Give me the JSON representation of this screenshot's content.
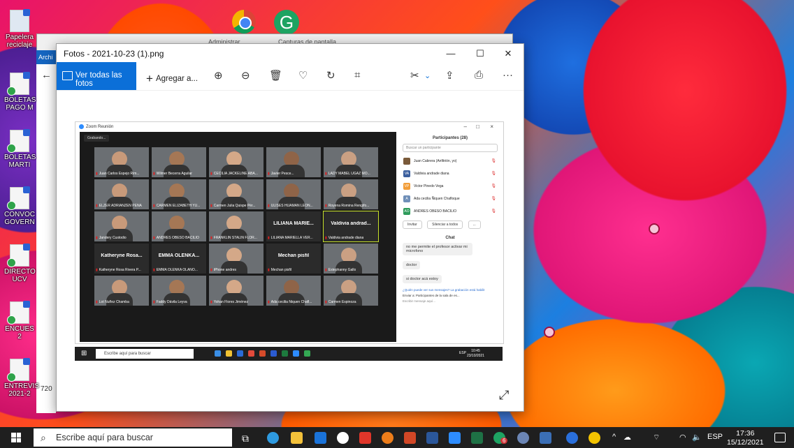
{
  "desktop": {
    "icons": [
      {
        "label": "Papelera reciclaje"
      },
      {
        "label": "BOLETAS PAGO M"
      },
      {
        "label": "BOLETAS MARTI"
      },
      {
        "label": "CONVOC GOVERN"
      },
      {
        "label": "DIRECTO UCV"
      },
      {
        "label": "ENCUES 2"
      },
      {
        "label": "ENTREVIS 2021-2"
      }
    ],
    "behind_window": {
      "tab1": "Administrar",
      "tab2": "Capturas de pantalla",
      "tab0": "Archi",
      "side_text": "720"
    }
  },
  "photos_app": {
    "title": "Fotos - 2021-10-23 (1).png",
    "see_all": "Ver todas las fotos",
    "add": "Agregar a...",
    "controls": {
      "minimize": "—",
      "maximize": "☐",
      "close": "✕",
      "more": "···"
    }
  },
  "zoom": {
    "title": "Zoom Reunión",
    "recording": "Grabando...",
    "participants_header": "Participantes (28)",
    "search_placeholder": "Buscar un participante",
    "tiles": [
      {
        "name": "Juan Carlos Espejo Rim..."
      },
      {
        "name": "Wilmer Becerra Aguilar"
      },
      {
        "name": "CECILIA JACKELINE ABA..."
      },
      {
        "name": "Javier Pesce..."
      },
      {
        "name": "LADY MABEL UGAZ MO..."
      },
      {
        "name": "ELZER ADRIANZEN PEÑA"
      },
      {
        "name": "CARMEN ELIZABETH YU..."
      },
      {
        "name": "Carmen Julia Quispe Pér..."
      },
      {
        "name": "ULISES HUAMAN LEON..."
      },
      {
        "name": "Royena Romina Rengifo..."
      },
      {
        "name": "Jandery Custodio"
      },
      {
        "name": "ANDRES OBESO BACILIO"
      },
      {
        "name": "FRANKLIN STALIN FLOR..."
      },
      {
        "name": "LILIANA MARIELLA VER...",
        "big": "LILIANA MARIE..."
      },
      {
        "name": "Valdivia andrade diana",
        "big": "Valdivia andrad..."
      },
      {
        "name": "Katheryne Rosa Rivera P...",
        "big": "Katheryne Rosa..."
      },
      {
        "name": "EMMA OLENKA OLANO...",
        "big": "EMMA OLENKA..."
      },
      {
        "name": "iPhone andres"
      },
      {
        "name": "Mechan pisfil",
        "big": "Mechan pisfil"
      },
      {
        "name": "Estephanny Gallo"
      },
      {
        "name": "Lot Nuñez Chamba"
      },
      {
        "name": "Faddy Dávila Leyva"
      },
      {
        "name": "Yohan Flores Jiménez"
      },
      {
        "name": "Ada cecilia Ñiquen Chafl..."
      },
      {
        "name": "Carmen Espinoza"
      }
    ],
    "participants": [
      {
        "initials": "",
        "name": "Juan Cabrera (Anfitrión, yo)"
      },
      {
        "initials": "VA",
        "name": "Valdivia andrade diana"
      },
      {
        "initials": "VP",
        "name": "Victor Pinedo Vega"
      },
      {
        "initials": "A",
        "name": "Ada cecilia Ñiquen Chafloque"
      },
      {
        "initials": "AO",
        "name": "ANDRES OBESO BACILIO"
      }
    ],
    "buttons": {
      "invite": "Invitar",
      "mute_all": "Silenciar a todos",
      "more": "..."
    },
    "chat_header": "Chat",
    "chat": [
      "no me permite el profesor activar mi microfono",
      "doctor",
      "si doctor acá estoy"
    ],
    "chat_note": "¿Quién puede ver sus mensajes? La grabación está habilit",
    "send_to_label": "Enviar a:",
    "send_to_value": "Participantes de la sala de es...",
    "input_placeholder": "Escribir mensaje aquí..."
  },
  "inner_taskbar": {
    "search": "Escribe aquí para buscar",
    "time": "10:45",
    "date": "23/10/2021",
    "lang": "ESP"
  },
  "taskbar": {
    "search": "Escribe aquí para buscar",
    "time": "17:36",
    "date": "15/12/2021",
    "lang": "ESP",
    "badge": "6"
  }
}
